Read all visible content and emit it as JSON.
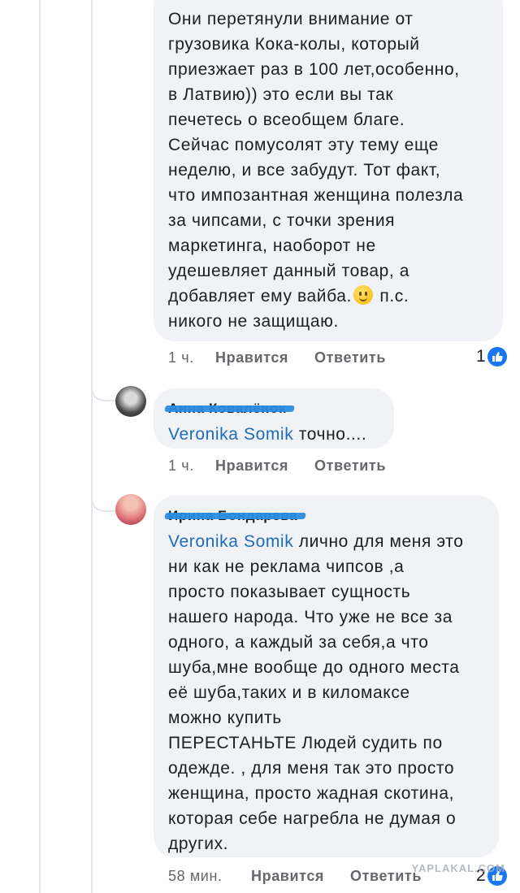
{
  "comments": [
    {
      "text": "Они перетянули внимание от\nгрузовика Кока-колы, который\nприезжает раз в 100 лет,особенно,\nв Латвию)) это если вы так\nпечетесь о всеобщем благе.\nСейчас помусолят эту тему еще\nнеделю, и все забудут. Тот факт,\nчто импозантная женщина полезла\nза чипсами, с точки зрения\nмаркетинга, наоборот не\nудешевляет данный товар, а\nдобавляет ему вайба.",
      "text_after_emoji": " п.с.\nникого не защищаю.",
      "time": "1 ч.",
      "like_label": "Нравится",
      "reply_label": "Ответить",
      "reaction_count": "1"
    },
    {
      "author": "Анна Ковалёнок",
      "mention": "Veronika Somik",
      "text": " точно....",
      "time": "1 ч.",
      "like_label": "Нравится",
      "reply_label": "Ответить"
    },
    {
      "author": "Ирина Бондарева",
      "mention": "Veronika Somik",
      "text": " лично для меня это\nни как не реклама чипсов ,а\nпросто показывает сущность\nнашего народа. Что уже не все за\nодного, а каждый за себя,а что\nшуба,мне вообще до одного места\nеё шуба,таких и в киломаксе\nможно купить\nПЕРЕСТАНЬТЕ Людей судить по\nодежде. , для меня так это просто\nженщина, просто жадная скотина,\nкоторая себе нагребла не думая о\nдругих.",
      "time": "58 мин.",
      "like_label": "Нравится",
      "reply_label": "Ответить",
      "reaction_count": "2"
    }
  ],
  "watermark": "YAPLAKAL.COM",
  "colors": {
    "bubble": "#f0f2f5",
    "mention": "#1e6bb8",
    "like": "#1877f2",
    "meta": "#65676b"
  },
  "icons": [
    "thumbs-up-icon",
    "smiley-emoji-icon"
  ]
}
